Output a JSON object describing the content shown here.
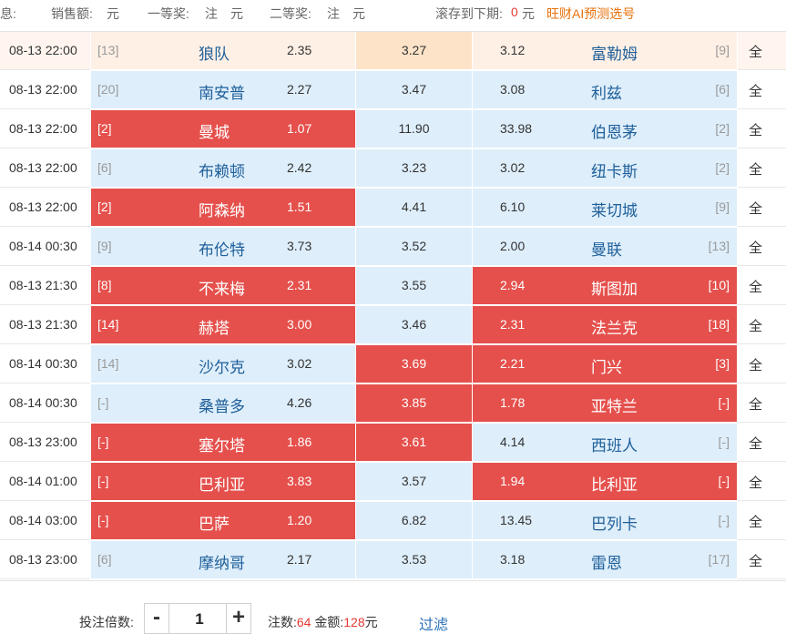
{
  "info_bar": {
    "label_prefix": "息:",
    "sales_label": "销售额:",
    "sales_unit": "元",
    "first_prize_label": "一等奖:",
    "first_prize_value": "注",
    "first_prize_unit": "元",
    "second_prize_label": "二等奖:",
    "second_prize_value": "注",
    "second_prize_unit": "元",
    "rollover_label": "滚存到下期:",
    "rollover_value": "0",
    "rollover_unit": "元",
    "ai_link": "旺财AI预测选号"
  },
  "matches": [
    {
      "time": "08-13 22:00",
      "home_rank": "[13]",
      "home": "狼队",
      "home_odd": "2.35",
      "draw_odd": "3.27",
      "away_odd": "3.12",
      "away": "富勒姆",
      "away_rank": "[9]",
      "all": "全",
      "sel_home": false,
      "sel_draw": false,
      "sel_away": false
    },
    {
      "time": "08-13 22:00",
      "home_rank": "[20]",
      "home": "南安普",
      "home_odd": "2.27",
      "draw_odd": "3.47",
      "away_odd": "3.08",
      "away": "利兹",
      "away_rank": "[6]",
      "all": "全",
      "sel_home": false,
      "sel_draw": false,
      "sel_away": false
    },
    {
      "time": "08-13 22:00",
      "home_rank": "[2]",
      "home": "曼城",
      "home_odd": "1.07",
      "draw_odd": "11.90",
      "away_odd": "33.98",
      "away": "伯恩茅",
      "away_rank": "[2]",
      "all": "全",
      "sel_home": true,
      "sel_draw": false,
      "sel_away": false
    },
    {
      "time": "08-13 22:00",
      "home_rank": "[6]",
      "home": "布赖顿",
      "home_odd": "2.42",
      "draw_odd": "3.23",
      "away_odd": "3.02",
      "away": "纽卡斯",
      "away_rank": "[2]",
      "all": "全",
      "sel_home": false,
      "sel_draw": false,
      "sel_away": false
    },
    {
      "time": "08-13 22:00",
      "home_rank": "[2]",
      "home": "阿森纳",
      "home_odd": "1.51",
      "draw_odd": "4.41",
      "away_odd": "6.10",
      "away": "莱切城",
      "away_rank": "[9]",
      "all": "全",
      "sel_home": true,
      "sel_draw": false,
      "sel_away": false
    },
    {
      "time": "08-14 00:30",
      "home_rank": "[9]",
      "home": "布伦特",
      "home_odd": "3.73",
      "draw_odd": "3.52",
      "away_odd": "2.00",
      "away": "曼联",
      "away_rank": "[13]",
      "all": "全",
      "sel_home": false,
      "sel_draw": false,
      "sel_away": false
    },
    {
      "time": "08-13 21:30",
      "home_rank": "[8]",
      "home": "不来梅",
      "home_odd": "2.31",
      "draw_odd": "3.55",
      "away_odd": "2.94",
      "away": "斯图加",
      "away_rank": "[10]",
      "all": "全",
      "sel_home": true,
      "sel_draw": false,
      "sel_away": true
    },
    {
      "time": "08-13 21:30",
      "home_rank": "[14]",
      "home": "赫塔",
      "home_odd": "3.00",
      "draw_odd": "3.46",
      "away_odd": "2.31",
      "away": "法兰克",
      "away_rank": "[18]",
      "all": "全",
      "sel_home": true,
      "sel_draw": false,
      "sel_away": true
    },
    {
      "time": "08-14 00:30",
      "home_rank": "[14]",
      "home": "沙尔克",
      "home_odd": "3.02",
      "draw_odd": "3.69",
      "away_odd": "2.21",
      "away": "门兴",
      "away_rank": "[3]",
      "all": "全",
      "sel_home": false,
      "sel_draw": true,
      "sel_away": true
    },
    {
      "time": "08-14 00:30",
      "home_rank": "[-]",
      "home": "桑普多",
      "home_odd": "4.26",
      "draw_odd": "3.85",
      "away_odd": "1.78",
      "away": "亚特兰",
      "away_rank": "[-]",
      "all": "全",
      "sel_home": false,
      "sel_draw": true,
      "sel_away": true
    },
    {
      "time": "08-13 23:00",
      "home_rank": "[-]",
      "home": "塞尔塔",
      "home_odd": "1.86",
      "draw_odd": "3.61",
      "away_odd": "4.14",
      "away": "西班人",
      "away_rank": "[-]",
      "all": "全",
      "sel_home": true,
      "sel_draw": true,
      "sel_away": false
    },
    {
      "time": "08-14 01:00",
      "home_rank": "[-]",
      "home": "巴利亚",
      "home_odd": "3.83",
      "draw_odd": "3.57",
      "away_odd": "1.94",
      "away": "比利亚",
      "away_rank": "[-]",
      "all": "全",
      "sel_home": true,
      "sel_draw": false,
      "sel_away": true
    },
    {
      "time": "08-14 03:00",
      "home_rank": "[-]",
      "home": "巴萨",
      "home_odd": "1.20",
      "draw_odd": "6.82",
      "away_odd": "13.45",
      "away": "巴列卡",
      "away_rank": "[-]",
      "all": "全",
      "sel_home": true,
      "sel_draw": false,
      "sel_away": false
    },
    {
      "time": "08-13 23:00",
      "home_rank": "[6]",
      "home": "摩纳哥",
      "home_odd": "2.17",
      "draw_odd": "3.53",
      "away_odd": "3.18",
      "away": "雷恩",
      "away_rank": "[17]",
      "all": "全",
      "sel_home": false,
      "sel_draw": false,
      "sel_away": false
    }
  ],
  "footer": {
    "multiplier_label": "投注倍数:",
    "minus": "-",
    "plus": "+",
    "multiplier_value": "1",
    "bets_label": "注数:",
    "bets_value": "64",
    "amount_label": "金额:",
    "amount_value": "128",
    "amount_unit": "元",
    "filter_link": "过滤"
  },
  "colors": {
    "selected": "#e5504c",
    "cell_bg": "#deeefb",
    "team_text": "#1f5f99",
    "accent_red": "#e53a36",
    "ai_link": "#e8700b"
  }
}
